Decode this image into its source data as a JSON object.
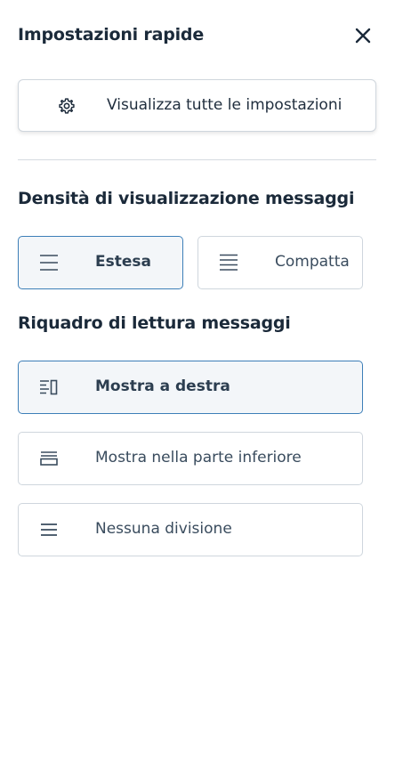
{
  "header": {
    "title": "Impostazioni rapide",
    "close_icon": "close-icon"
  },
  "all_settings": {
    "label": "Visualizza tutte le impostazioni",
    "icon": "gear-icon"
  },
  "density": {
    "title": "Densità di visualizzazione messaggi",
    "options": [
      {
        "label": "Estesa",
        "icon": "density-extended-icon",
        "selected": true
      },
      {
        "label": "Compatta",
        "icon": "density-compact-icon",
        "selected": false
      }
    ]
  },
  "reading_pane": {
    "title": "Riquadro di lettura messaggi",
    "options": [
      {
        "label": "Mostra a destra",
        "icon": "pane-right-icon",
        "selected": true
      },
      {
        "label": "Mostra nella parte inferiore",
        "icon": "pane-bottom-icon",
        "selected": false
      },
      {
        "label": "Nessuna divisione",
        "icon": "pane-none-icon",
        "selected": false
      }
    ]
  },
  "colors": {
    "selected_border": "#3d7fb8",
    "selected_bg": "#f3f6f9",
    "border": "#cfd6dd",
    "text": "#1f2d3d"
  }
}
